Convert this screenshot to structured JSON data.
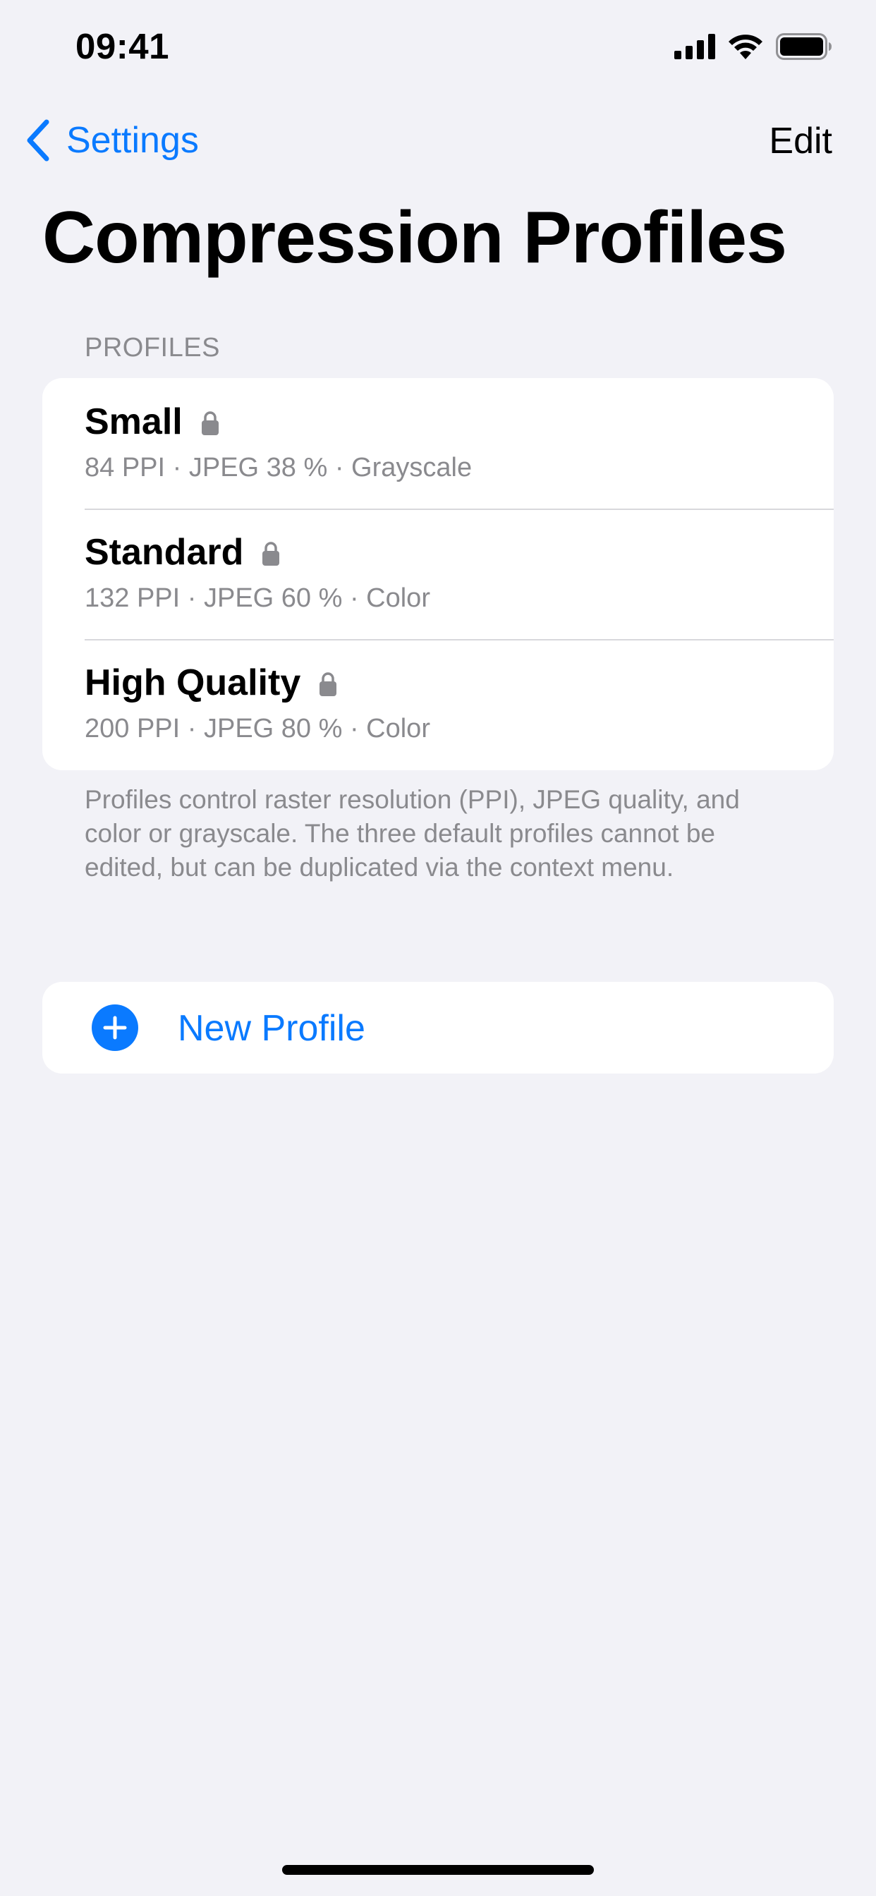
{
  "status_bar": {
    "time": "09:41",
    "icons": [
      "cellular-signal-icon",
      "wifi-icon",
      "battery-icon"
    ]
  },
  "nav": {
    "back_label": "Settings",
    "edit_label": "Edit",
    "accent_color": "#0a7aff"
  },
  "title": "Compression Profiles",
  "profiles_section": {
    "header": "PROFILES",
    "items": [
      {
        "name": "Small",
        "detail": "84 PPI · JPEG 38 % · Grayscale",
        "locked": true,
        "icon": "lock-icon"
      },
      {
        "name": "Standard",
        "detail": "132 PPI · JPEG 60 % · Color",
        "locked": true,
        "icon": "lock-icon"
      },
      {
        "name": "High Quality",
        "detail": "200 PPI · JPEG 80 % · Color",
        "locked": true,
        "icon": "lock-icon"
      }
    ],
    "footer": "Profiles control raster resolution (PPI), JPEG quality, and color or grayscale. The three default profiles cannot be edited, but can be duplicated via the context menu."
  },
  "new_profile": {
    "label": "New Profile",
    "icon": "plus-circle-icon"
  }
}
